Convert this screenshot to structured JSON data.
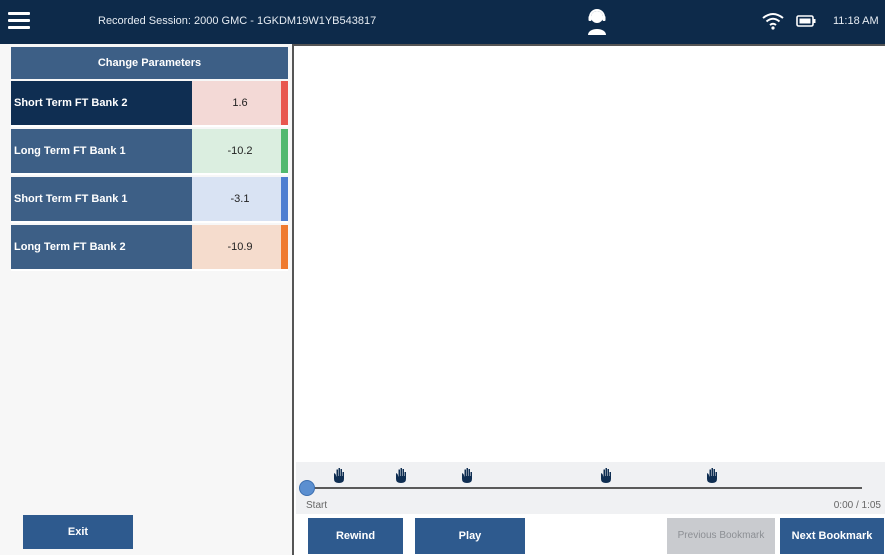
{
  "header": {
    "menu_icon": "hamburger-menu-icon",
    "title": "Recorded Session: 2000 GMC - 1GKDM19W1YB543817",
    "tech_icon": "technician-headset-icon",
    "wifi_icon": "wifi-icon",
    "battery_icon": "battery-icon",
    "time": "11:18 AM"
  },
  "sidebar": {
    "change_parameters_label": "Change Parameters",
    "params": [
      {
        "label": "Short Term FT Bank 2",
        "value": "1.6",
        "color": "#e8574f",
        "tint": "#f3d9d6",
        "selected": true
      },
      {
        "label": "Long Term FT Bank 1",
        "value": "-10.2",
        "color": "#52b96f",
        "tint": "#dbeee0",
        "selected": false
      },
      {
        "label": "Short Term FT Bank 1",
        "value": "-3.1",
        "color": "#4f7fd1",
        "tint": "#d9e3f3",
        "selected": false
      },
      {
        "label": "Long Term FT Bank 2",
        "value": "-10.9",
        "color": "#ef7a2f",
        "tint": "#f5dccd",
        "selected": false
      }
    ],
    "exit_label": "Exit"
  },
  "timeline": {
    "start_label": "Start",
    "time_display": "0:00 / 1:05",
    "position": 0.0,
    "bookmark_icon": "hand-bookmark-icon",
    "bookmarks": [
      0.06,
      0.17,
      0.29,
      0.54,
      0.73
    ]
  },
  "controls": {
    "rewind_label": "Rewind",
    "play_label": "Play",
    "prev_bookmark_label": "Previous Bookmark",
    "next_bookmark_label": "Next Bookmark"
  },
  "colors": {
    "header_bg": "#0d2a4a",
    "accent": "#2e5a8e",
    "param_bg": "#3d5f86",
    "selected_bg": "#0f2e52"
  }
}
